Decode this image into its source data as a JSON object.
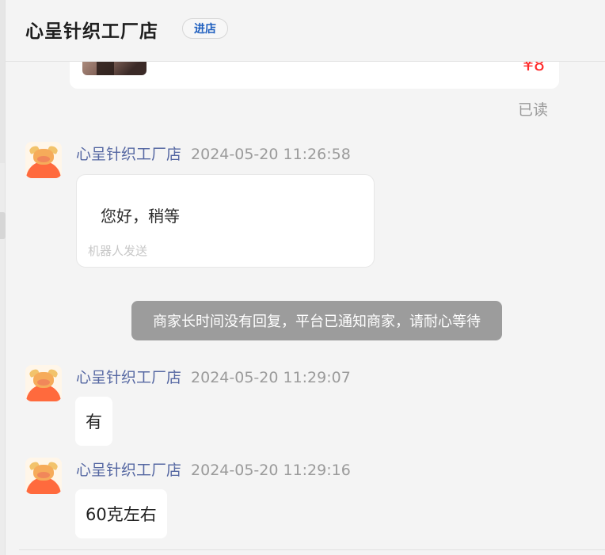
{
  "header": {
    "shop_name": "心呈针织工厂店",
    "enter_store_label": "进店"
  },
  "product": {
    "price": "¥8"
  },
  "read_status": "已读",
  "messages": [
    {
      "sender": "心呈针织工厂店",
      "time": "2024-05-20 11:26:58",
      "text": "您好，稍等",
      "robot_tag": "机器人发送"
    },
    {
      "system_notice": "商家长时间没有回复，平台已通知商家，请耐心等待"
    },
    {
      "sender": "心呈针织工厂店",
      "time": "2024-05-20 11:29:07",
      "text": "有"
    },
    {
      "sender": "心呈针织工厂店",
      "time": "2024-05-20 11:29:16",
      "text": "60克左右"
    }
  ],
  "colors": {
    "accent_blue": "#1f5fbf",
    "sender_name": "#5567a2",
    "price_red": "#ff2a2a",
    "notice_gray": "#9c9c9c"
  }
}
